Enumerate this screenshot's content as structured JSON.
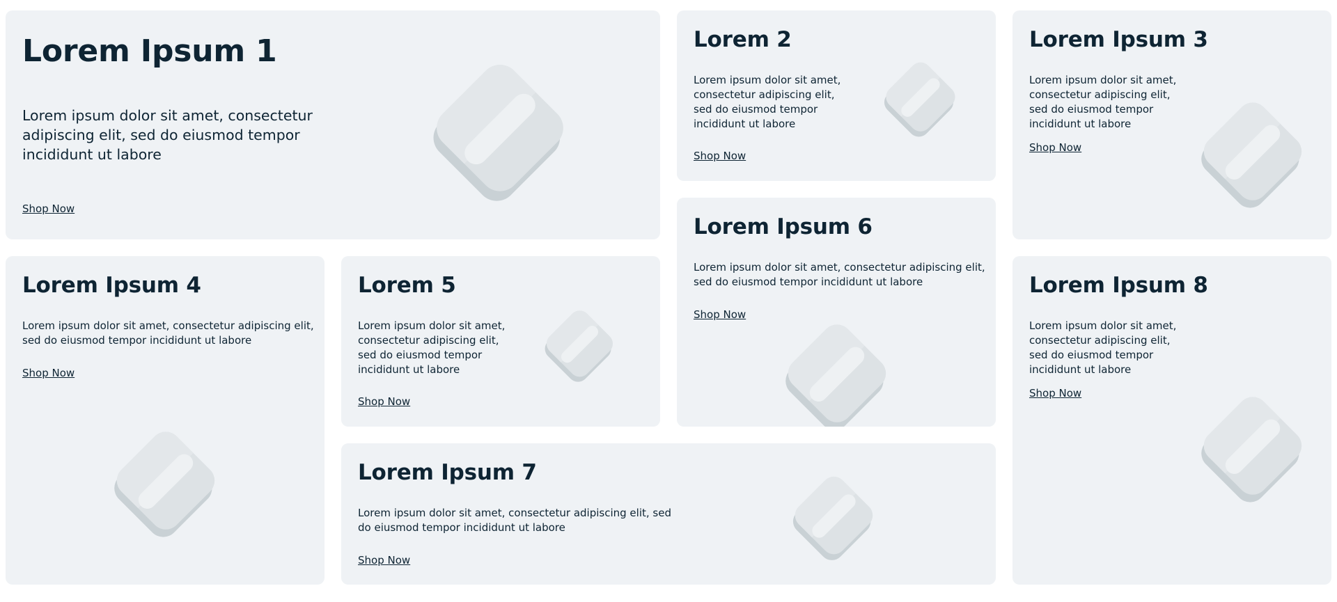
{
  "colors": {
    "card_bg": "#eff2f5",
    "text": "#0e2433",
    "graphic_light": "#e0e4e7",
    "graphic_mid": "#d5dcdf",
    "graphic_dark": "#c9d1d5",
    "graphic_bar": "#eef1f3"
  },
  "cards": [
    {
      "title": "Lorem Ipsum 1",
      "description": "Lorem ipsum dolor sit amet, consectetur adipiscing elit, sed do eiusmod tempor incididunt ut labore",
      "link": "Shop Now",
      "icon": "product-placeholder-icon"
    },
    {
      "title": "Lorem 2",
      "description": "Lorem ipsum dolor sit amet, consectetur adipiscing elit, sed do eiusmod tempor incididunt ut labore",
      "link": "Shop Now",
      "icon": "product-placeholder-icon"
    },
    {
      "title": "Lorem Ipsum 3",
      "description": "Lorem ipsum dolor sit amet, consectetur adipiscing elit, sed do eiusmod tempor incididunt ut labore",
      "link": "Shop Now",
      "icon": "product-placeholder-icon"
    },
    {
      "title": "Lorem Ipsum 4",
      "description": "Lorem ipsum dolor sit amet, consectetur adipiscing elit, sed do eiusmod tempor incididunt ut labore",
      "link": "Shop Now",
      "icon": "product-placeholder-icon"
    },
    {
      "title": "Lorem 5",
      "description": "Lorem ipsum dolor sit amet, consectetur adipiscing elit, sed do eiusmod tempor incididunt ut labore",
      "link": "Shop Now",
      "icon": "product-placeholder-icon"
    },
    {
      "title": "Lorem Ipsum 6",
      "description": "Lorem ipsum dolor sit amet, consectetur adipiscing elit, sed do eiusmod tempor incididunt ut labore",
      "link": "Shop Now",
      "icon": "product-placeholder-icon"
    },
    {
      "title": "Lorem Ipsum 7",
      "description": "Lorem ipsum dolor sit amet, consectetur adipiscing elit, sed do eiusmod tempor incididunt ut labore",
      "link": "Shop Now",
      "icon": "product-placeholder-icon"
    },
    {
      "title": "Lorem Ipsum 8",
      "description": "Lorem ipsum dolor sit amet, consectetur adipiscing elit, sed do eiusmod tempor incididunt ut labore",
      "link": "Shop Now",
      "icon": "product-placeholder-icon"
    }
  ]
}
